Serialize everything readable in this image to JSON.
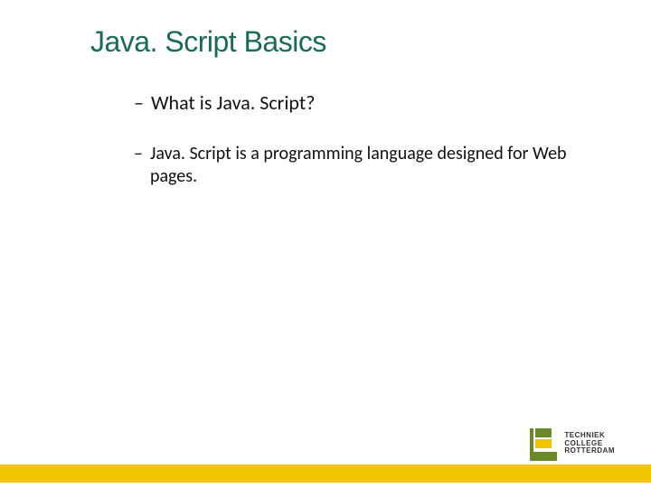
{
  "title": "Java. Script Basics",
  "bullets": [
    {
      "dash": "–",
      "text": "What is Java. Script?"
    },
    {
      "dash": "–",
      "text": "Java. Script is a programming language designed for Web pages."
    }
  ],
  "logo": {
    "line1": "TECHNIEK",
    "line2": "COLLEGE",
    "line3": "ROTTERDAM",
    "sub": ""
  }
}
